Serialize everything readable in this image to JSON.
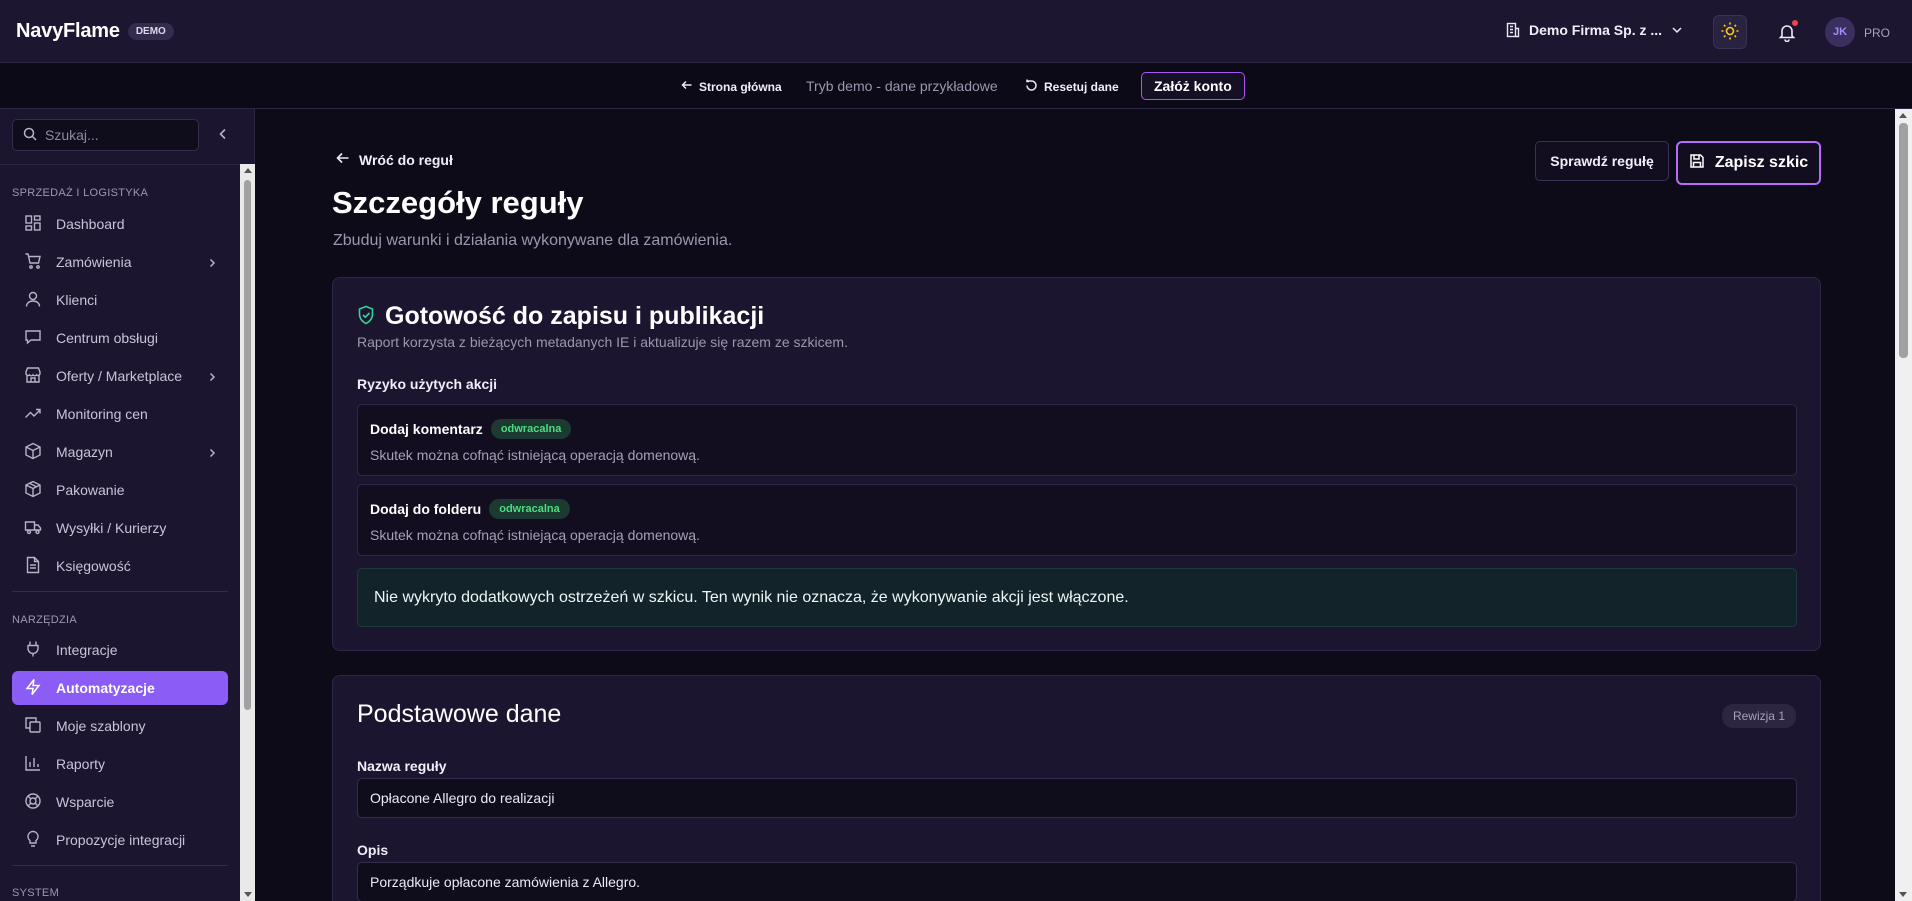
{
  "app": {
    "brand": "NavyFlame",
    "badge": "DEMO",
    "company": "Demo Firma Sp. z ...",
    "avatar_initials": "JK",
    "plan": "PRO"
  },
  "demo_bar": {
    "home": "Strona główna",
    "text": "Tryb demo - dane przykładowe",
    "reset": "Resetuj dane",
    "signup": "Załóż konto"
  },
  "sidebar": {
    "search_placeholder": "Szukaj...",
    "section_sales": "SPRZEDAŻ I LOGISTYKA",
    "section_tools": "NARZĘDZIA",
    "section_system": "SYSTEM",
    "items": [
      {
        "label": "Dashboard",
        "icon": "dashboard-icon"
      },
      {
        "label": "Zamówienia",
        "icon": "cart-icon"
      },
      {
        "label": "Klienci",
        "icon": "user-icon"
      },
      {
        "label": "Centrum obsługi",
        "icon": "chat-icon"
      },
      {
        "label": "Oferty / Marketplace",
        "icon": "store-icon"
      },
      {
        "label": "Monitoring cen",
        "icon": "trend-icon"
      },
      {
        "label": "Magazyn",
        "icon": "box-icon"
      },
      {
        "label": "Pakowanie",
        "icon": "package-icon"
      },
      {
        "label": "Wysyłki / Kurierzy",
        "icon": "truck-icon"
      },
      {
        "label": "Księgowość",
        "icon": "document-icon"
      },
      {
        "label": "Integracje",
        "icon": "plug-icon"
      },
      {
        "label": "Automatyzacje",
        "icon": "bolt-icon"
      },
      {
        "label": "Moje szablony",
        "icon": "copy-icon"
      },
      {
        "label": "Raporty",
        "icon": "bar-chart-icon"
      },
      {
        "label": "Wsparcie",
        "icon": "lifebuoy-icon"
      },
      {
        "label": "Propozycje integracji",
        "icon": "bulb-icon"
      }
    ]
  },
  "page": {
    "back": "Wróć do reguł",
    "title": "Szczegóły reguły",
    "subtitle": "Zbuduj warunki i działania wykonywane dla zamówienia.",
    "check_button": "Sprawdź regułę",
    "save_button": "Zapisz szkic"
  },
  "readiness": {
    "title": "Gotowość do zapisu i publikacji",
    "subtitle": "Raport korzysta z bieżących metadanych IE i aktualizuje się razem ze szkicem.",
    "risk_label": "Ryzyko użytych akcji",
    "risks": [
      {
        "title": "Dodaj komentarz",
        "badge": "odwracalna",
        "desc": "Skutek można cofnąć istniejącą operacją domenową."
      },
      {
        "title": "Dodaj do folderu",
        "badge": "odwracalna",
        "desc": "Skutek można cofnąć istniejącą operacją domenową."
      }
    ],
    "info": "Nie wykryto dodatkowych ostrzeżeń w szkicu. Ten wynik nie oznacza, że wykonywanie akcji jest włączone."
  },
  "basic": {
    "title": "Podstawowe dane",
    "revision": "Rewizja 1",
    "name_label": "Nazwa reguły",
    "name_value": "Opłacone Allegro do realizacji",
    "desc_label": "Opis",
    "desc_value": "Porządkuje opłacone zamówienia z Allegro."
  },
  "colors": {
    "accent": "#8b5cf6",
    "success": "#4ade80",
    "background": "#0e0b19"
  }
}
